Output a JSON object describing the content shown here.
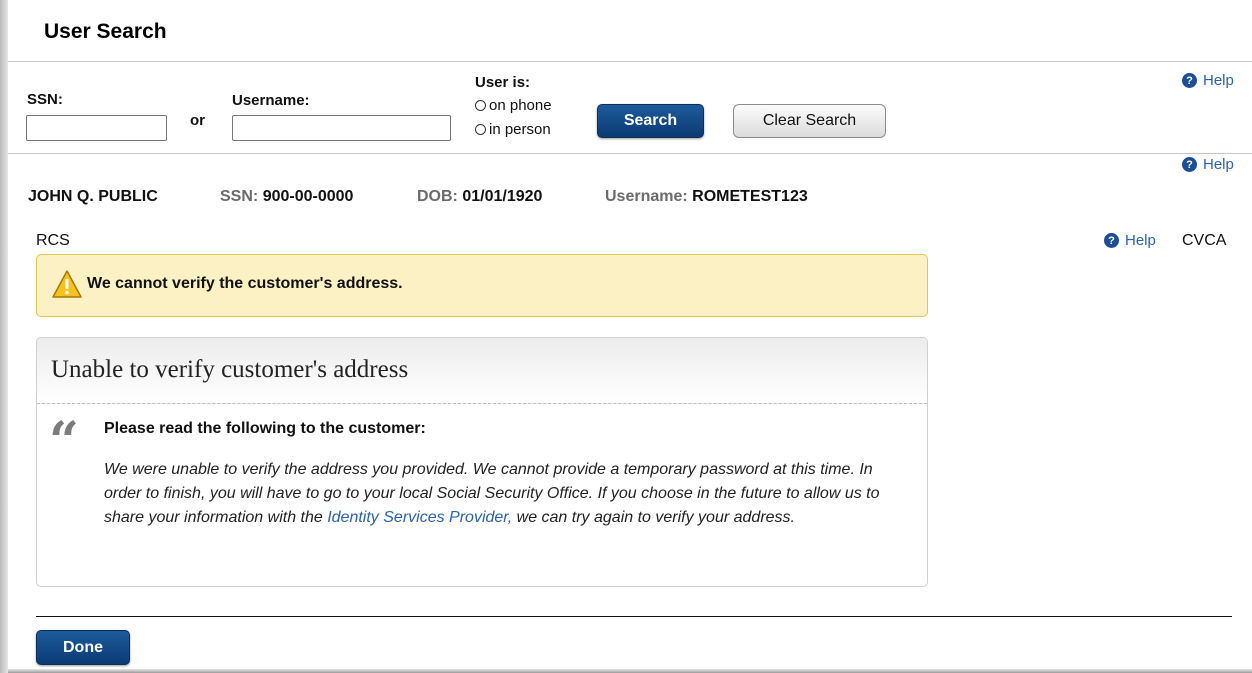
{
  "page": {
    "title": "User Search"
  },
  "search": {
    "ssn_label": "SSN:",
    "or_label": "or",
    "username_label": "Username:",
    "ssn_value": "",
    "username_value": "",
    "user_is_label": "User is:",
    "options": [
      "on phone",
      "in person"
    ],
    "search_button": "Search",
    "clear_button": "Clear Search"
  },
  "help": {
    "label": "Help"
  },
  "customer": {
    "name": "JOHN Q. PUBLIC",
    "ssn_label": "SSN:",
    "ssn": "900-00-0000",
    "dob_label": "DOB:",
    "dob": "01/01/1920",
    "username_label": "Username:",
    "username": "ROMETEST123"
  },
  "section": {
    "left": "RCS",
    "right": "CVCA"
  },
  "alert": {
    "text": "We cannot verify the customer's address."
  },
  "card": {
    "title": "Unable to verify customer's address",
    "quote_mark": "“",
    "sub": "Please read the following to the customer:",
    "body_pre": "We were unable to verify the address you provided. We cannot provide a temporary password at this time. In order to finish, you will have to go to your local Social Security Office. If you choose in the future to allow us to share your information with the ",
    "link": "Identity Services Provider,",
    "body_post": " we can try again to verify your address."
  },
  "footer": {
    "done_button": "Done"
  },
  "colors": {
    "primary": "#0c3b72",
    "link": "#2a62b3",
    "alert_bg": "#fbf1c4",
    "alert_border": "#e2c650"
  }
}
